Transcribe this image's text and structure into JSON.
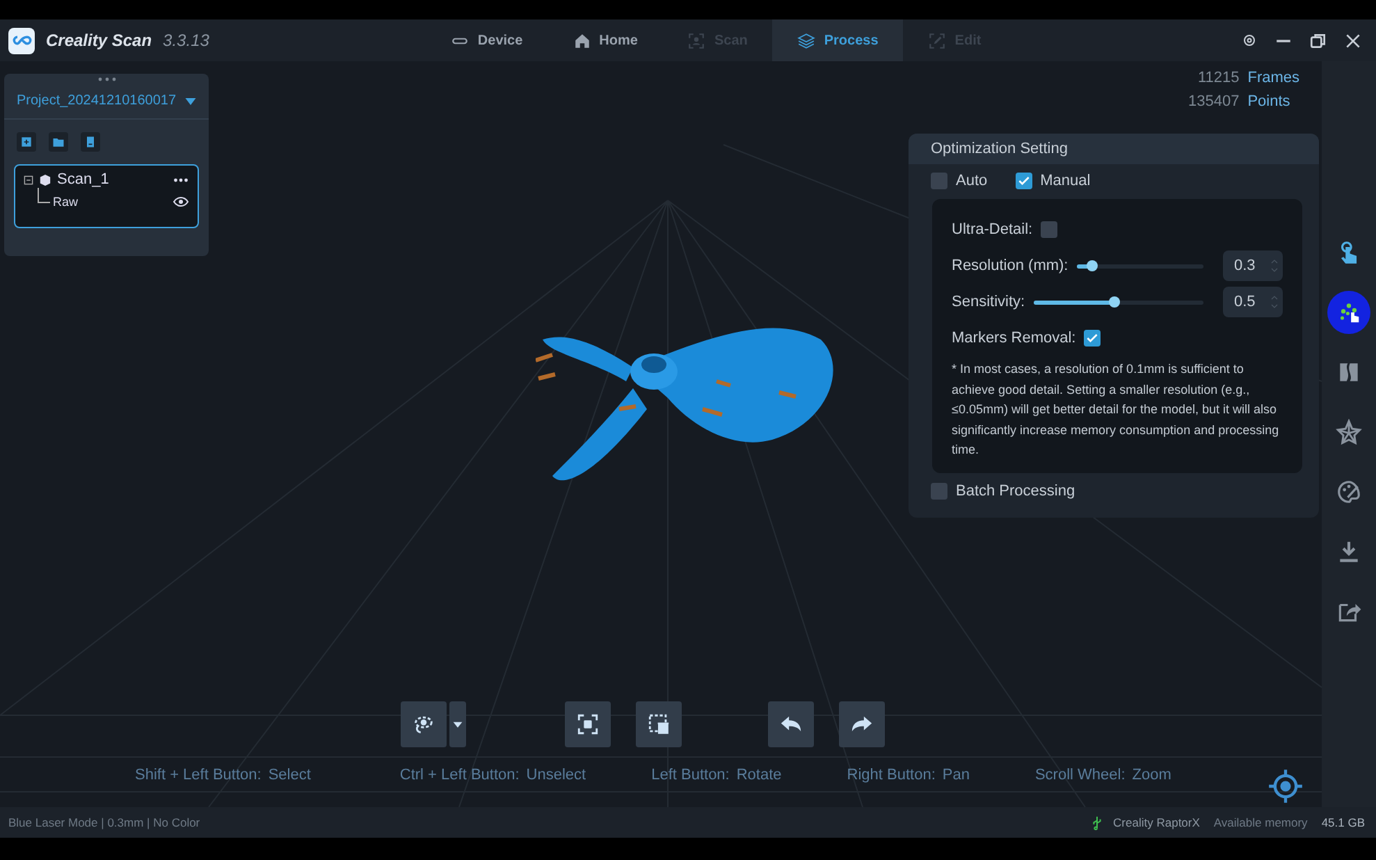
{
  "window": {
    "app_name": "Creality Scan",
    "version": "3.3.13"
  },
  "tabs": [
    {
      "label": "Device",
      "kind": "device",
      "selected": false,
      "disabled": false
    },
    {
      "label": "Home",
      "kind": "home",
      "selected": false,
      "disabled": false
    },
    {
      "label": "Scan",
      "kind": "scan",
      "selected": false,
      "disabled": true
    },
    {
      "label": "Process",
      "kind": "process",
      "selected": true,
      "disabled": false
    },
    {
      "label": "Edit",
      "kind": "edit",
      "selected": false,
      "disabled": true
    }
  ],
  "project_panel": {
    "project": "Project_20241210160017",
    "scan": {
      "name": "Scan_1",
      "expanded": true,
      "selected": true,
      "children": [
        {
          "name": "Raw",
          "visible": true
        }
      ]
    }
  },
  "stats": {
    "frames": {
      "value": "11215",
      "label": "Frames"
    },
    "points": {
      "value": "135407",
      "label": "Points"
    }
  },
  "optimization": {
    "title": "Optimization Setting",
    "modes": [
      {
        "label": "Auto",
        "checked": false
      },
      {
        "label": "Manual",
        "checked": true
      }
    ],
    "ultra_detail": {
      "label": "Ultra-Detail:",
      "checked": false
    },
    "sliders": [
      {
        "label": "Resolution (mm):",
        "level": 0.12,
        "value": "0.3"
      },
      {
        "label": "Sensitivity:",
        "level": 0.48,
        "value": "0.5"
      }
    ],
    "markers_removal": {
      "label": "Markers Removal:",
      "checked": true
    },
    "note": "* In most cases, a resolution of 0.1mm is sufficient to achieve good detail. Setting a smaller resolution (e.g., ≤0.05mm) will get better detail for the model, but it will also significantly increase memory consumption and processing time.",
    "batch": {
      "label": "Batch Processing",
      "checked": false
    }
  },
  "tools": [
    {
      "kind": "touch",
      "selected": false
    },
    {
      "kind": "points",
      "selected": true
    },
    {
      "kind": "mesh",
      "selected": false
    },
    {
      "kind": "star",
      "selected": false
    },
    {
      "kind": "palette",
      "selected": false
    },
    {
      "kind": "download",
      "selected": false
    },
    {
      "kind": "export",
      "selected": false
    }
  ],
  "toolbar": [
    {
      "kind": "lasso"
    },
    {
      "kind": "select-all"
    },
    {
      "kind": "delete"
    },
    {
      "kind": "undo"
    },
    {
      "kind": "redo"
    }
  ],
  "hints": [
    {
      "key": "Shift + Left Button:",
      "action": "Select"
    },
    {
      "key": "Ctrl + Left Button:",
      "action": "Unselect"
    },
    {
      "key": "Left Button:",
      "action": "Rotate"
    },
    {
      "key": "Right Button:",
      "action": "Pan"
    },
    {
      "key": "Scroll Wheel:",
      "action": "Zoom"
    }
  ],
  "status_bar": {
    "mode": "Blue Laser Mode | 0.3mm | No Color",
    "device": "Creality RaptorX",
    "memory_label": "Available memory",
    "memory": "45.1 GB"
  }
}
